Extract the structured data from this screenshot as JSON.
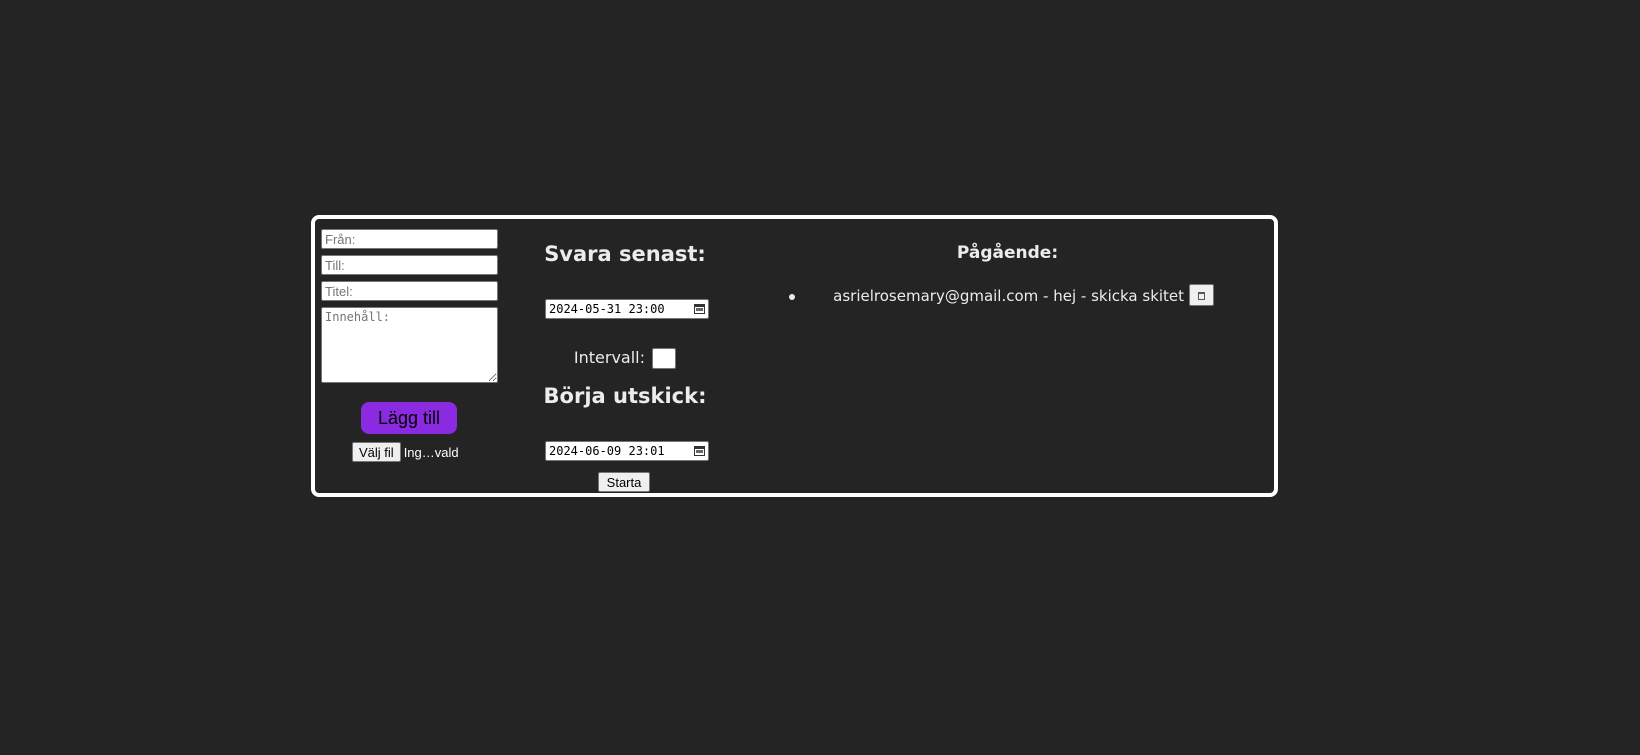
{
  "form": {
    "from_placeholder": "Från:",
    "to_placeholder": "Till:",
    "title_placeholder": "Titel:",
    "content_placeholder": "Innehåll:",
    "add_label": "Lägg till",
    "file_button_label": "Välj fil",
    "file_status": "Ing…vald"
  },
  "schedule": {
    "reply_heading": "Svara senast:",
    "reply_datetime": "2024-05-31 23:00",
    "interval_label": "Intervall:",
    "start_heading": "Börja utskick:",
    "start_datetime": "2024-06-09 23:01",
    "start_button_label": "Starta"
  },
  "ongoing": {
    "title": "Pågående:",
    "items": [
      {
        "text": "asrielrosemary@gmail.com - hej - skicka skitet",
        "delete_icon": "trash-icon"
      }
    ]
  },
  "colors": {
    "background": "#242424",
    "panel_border": "#ffffff",
    "accent": "#8a2be2"
  }
}
